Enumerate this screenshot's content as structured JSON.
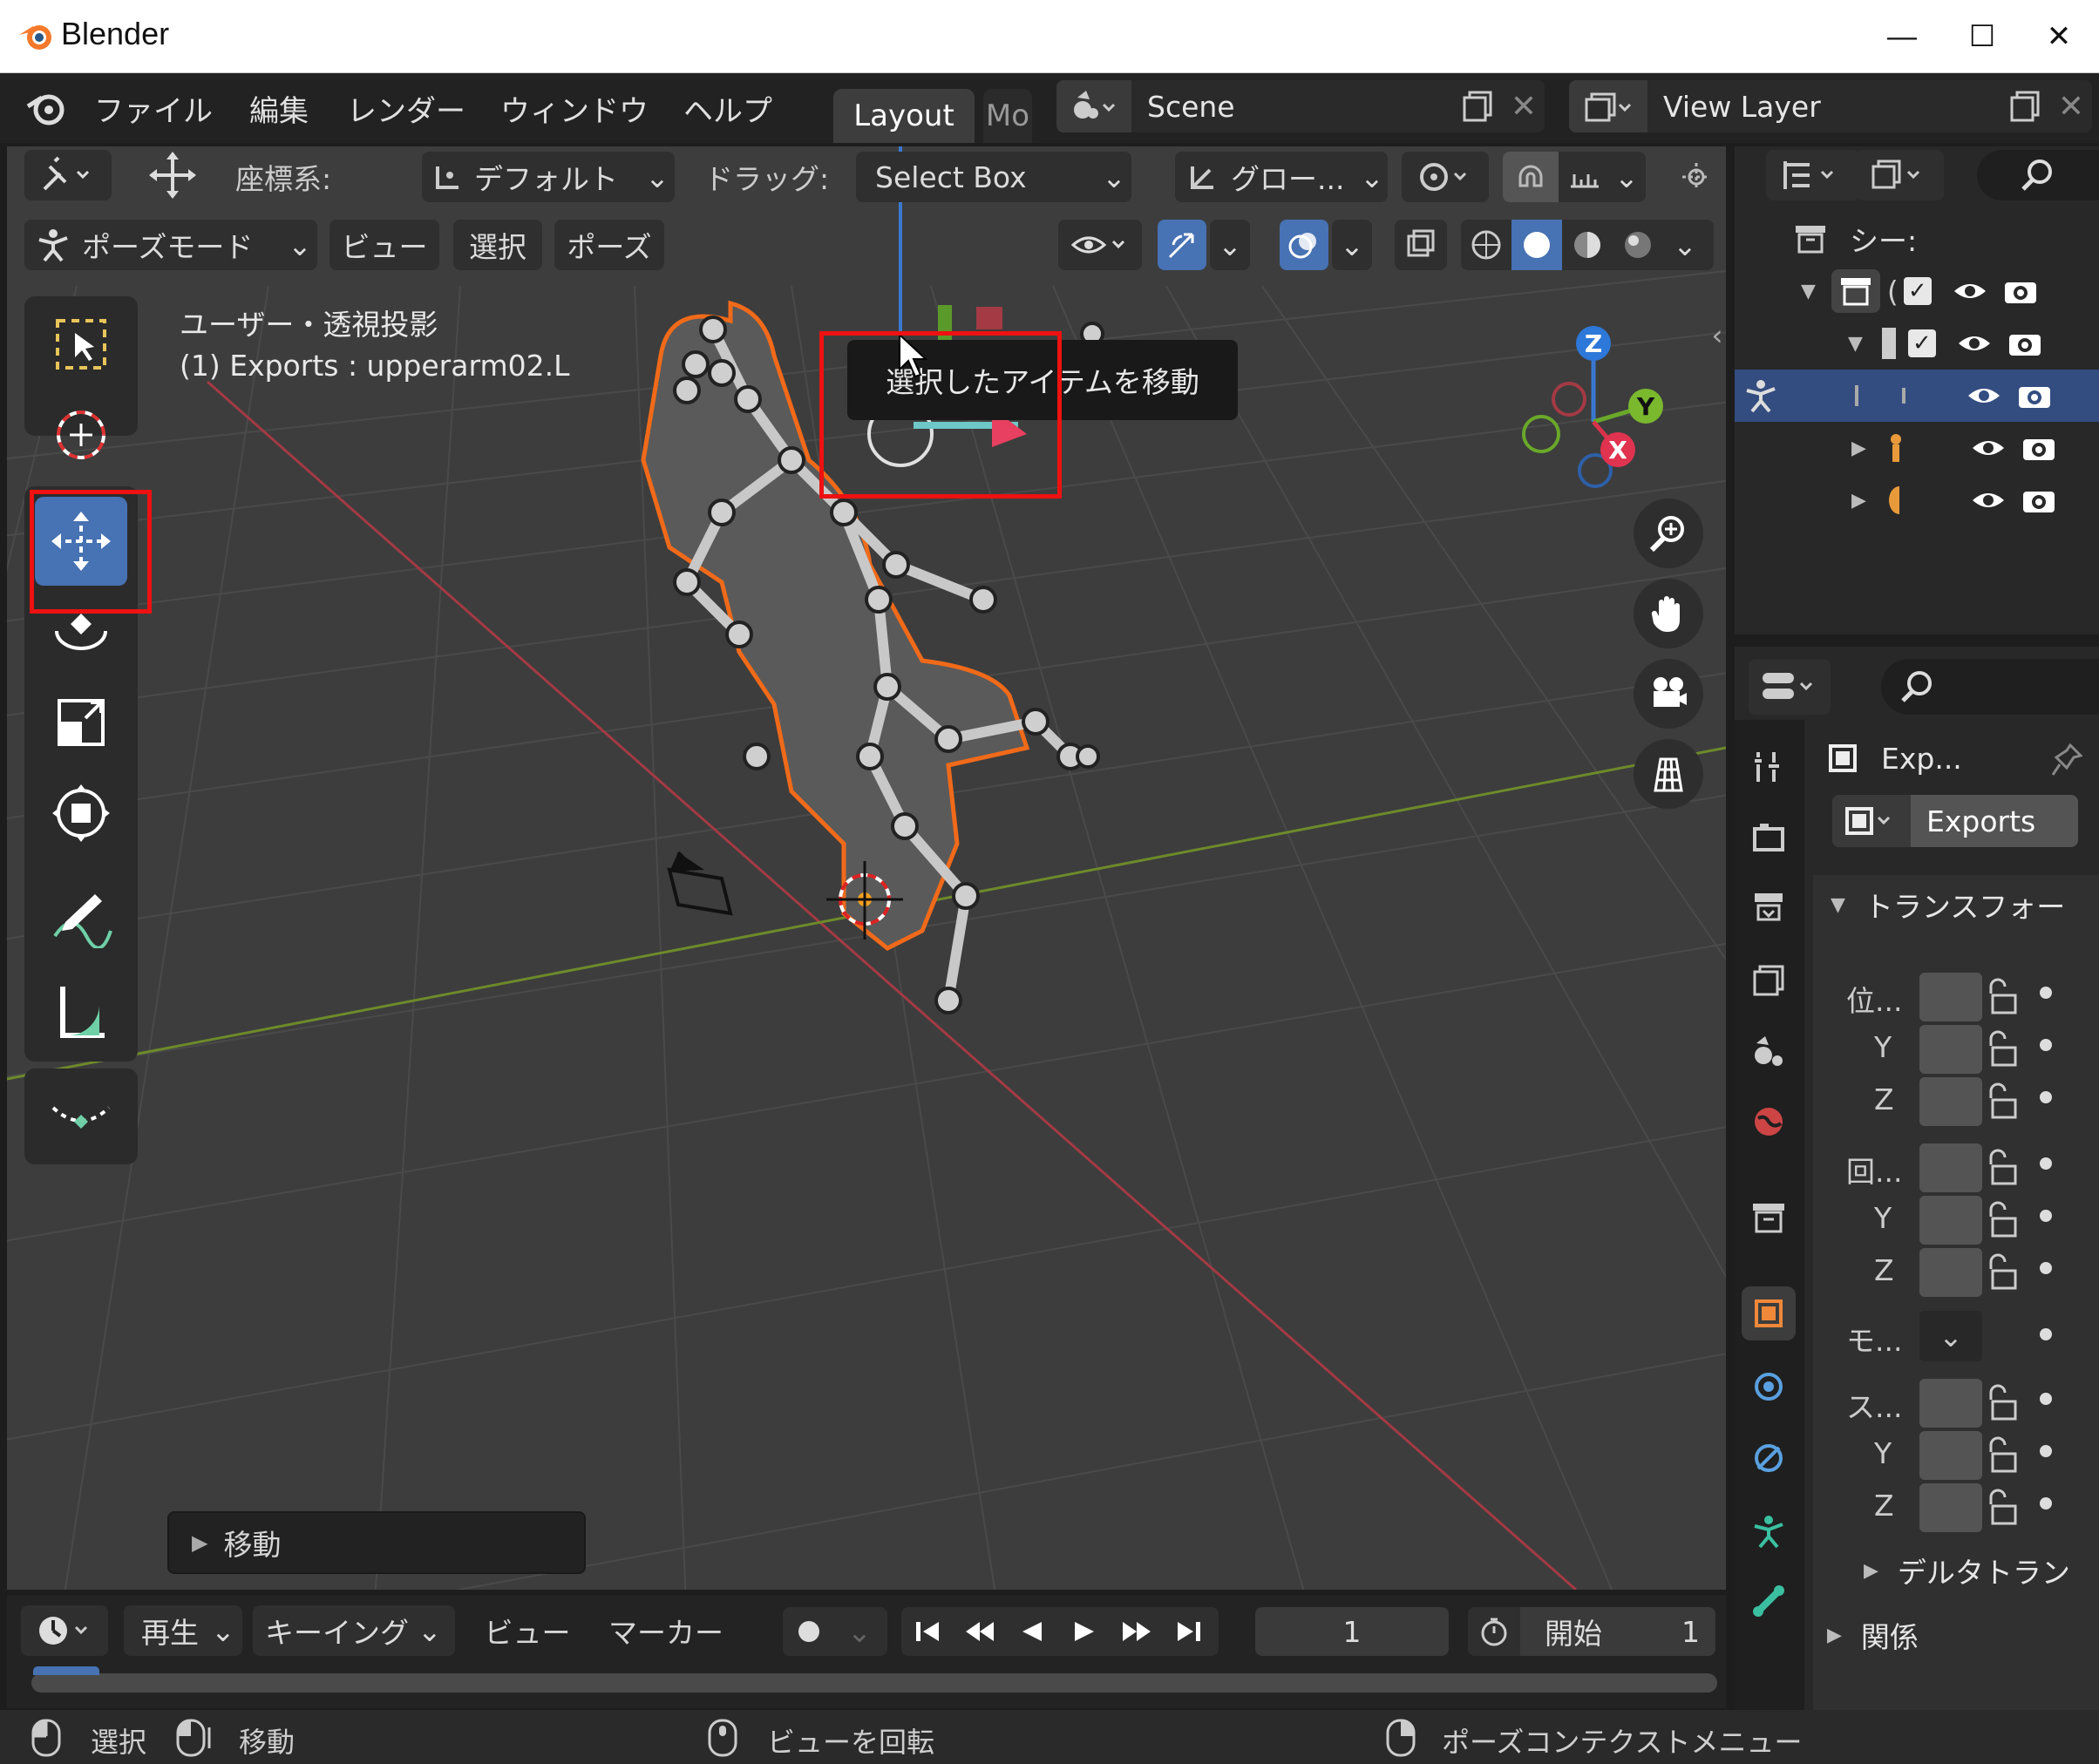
{
  "window": {
    "title": "Blender",
    "minimize": "—",
    "maximize": "☐",
    "close": "✕"
  },
  "menu": [
    "ファイル",
    "編集",
    "レンダー",
    "ウィンドウ",
    "ヘルプ"
  ],
  "workspace_tabs": {
    "active": "Layout",
    "next": "Mo"
  },
  "scene": {
    "name": "Scene",
    "view_layer": "View Layer"
  },
  "tool_header": {
    "coord_label": "座標系:",
    "coord_value": "デフォルト",
    "drag_label": "ドラッグ:",
    "drag_value": "Select Box",
    "orientation": "グロー..."
  },
  "viewport_header": {
    "mode": "ポーズモード",
    "view": "ビュー",
    "select": "選択",
    "pose": "ポーズ"
  },
  "viewport": {
    "perspective": "ユーザー・透視投影",
    "active_object": "(1) Exports : upperarm02.L",
    "tooltip": "選択したアイテムを移動",
    "last_op": "移動"
  },
  "gizmo": {
    "x": "X",
    "y": "Y",
    "z": "Z"
  },
  "outliner": {
    "scene_label": "シー:"
  },
  "properties": {
    "object_name": "Exp...",
    "data_name": "Exports",
    "transform_header": "トランスフォー",
    "location_label": "位...",
    "rotation_label": "回...",
    "mode_label": "モ...",
    "scale_label": "ス...",
    "axis_y": "Y",
    "axis_z": "Z",
    "delta_header": "デルタトラン",
    "relations_header": "関係"
  },
  "timeline": {
    "playback": "再生",
    "keying": "キーイング",
    "view": "ビュー",
    "marker": "マーカー",
    "frame": "1",
    "start_label": "開始",
    "start_value": "1"
  },
  "statusbar": {
    "select": "選択",
    "move": "移動",
    "rotate_view": "ビューを回転",
    "context_menu": "ポーズコンテクストメニュー"
  },
  "colors": {
    "accent": "#4772b3",
    "highlight": "#e11111",
    "outline": "#f06a1a",
    "bg_viewport": "#3d3d3d"
  }
}
